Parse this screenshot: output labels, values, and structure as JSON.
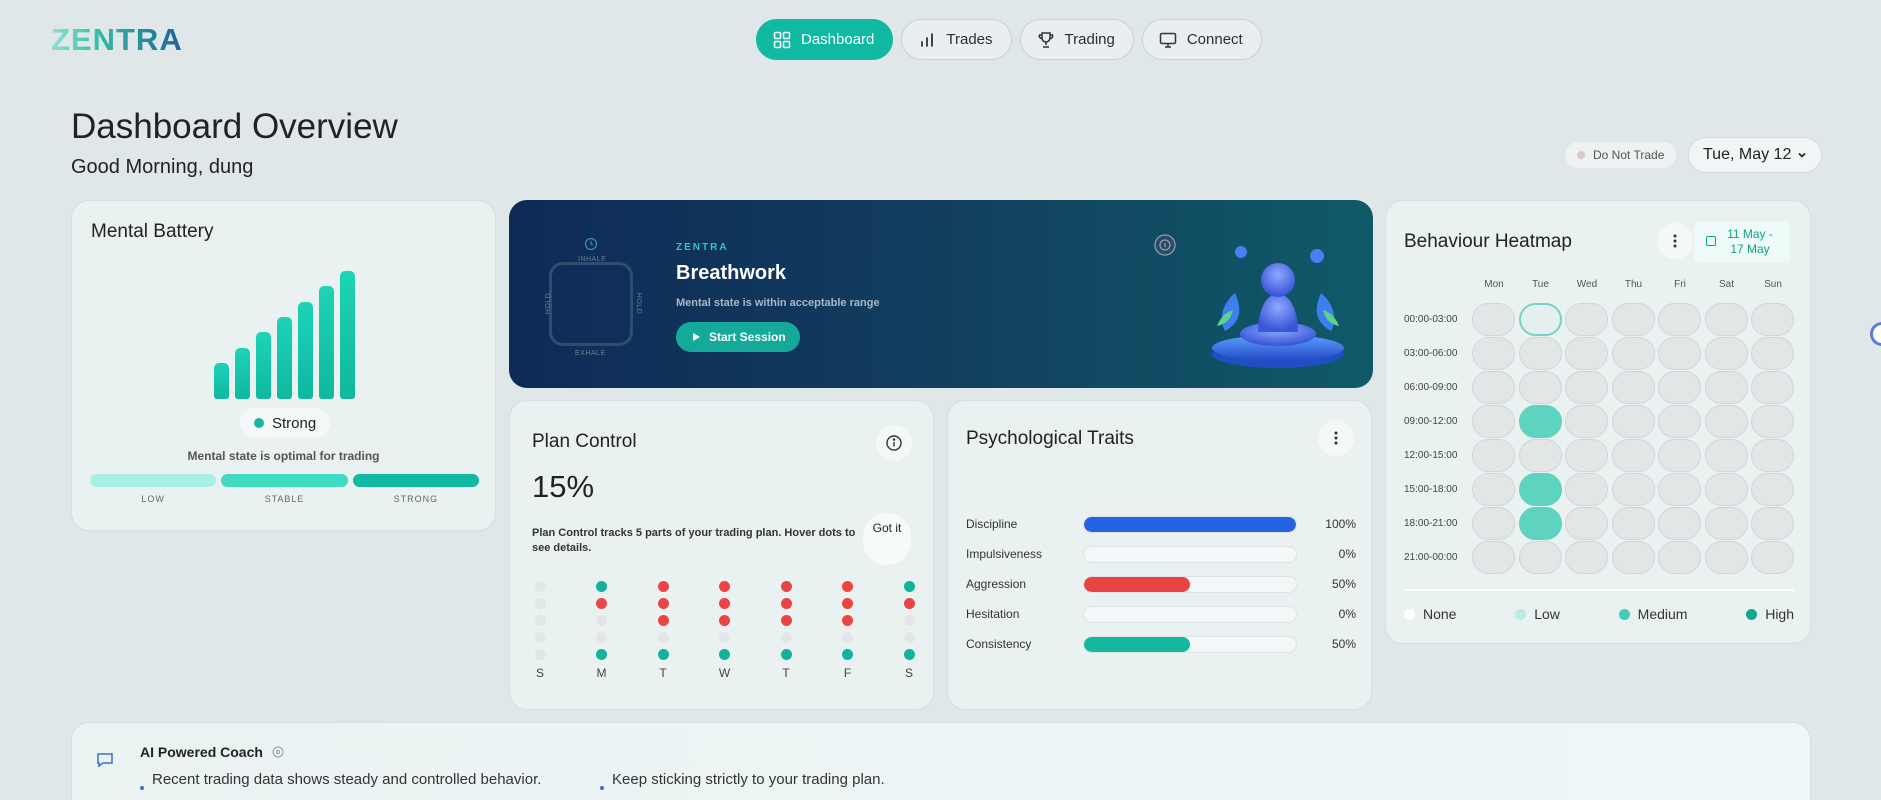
{
  "brand": {
    "logo": "ZENTRA"
  },
  "nav": [
    {
      "label": "Dashboard",
      "icon": "grid-icon",
      "active": true
    },
    {
      "label": "Trades",
      "icon": "bar-chart-icon",
      "active": false
    },
    {
      "label": "Trading",
      "icon": "trophy-icon",
      "active": false
    },
    {
      "label": "Connect",
      "icon": "monitor-icon",
      "active": false
    }
  ],
  "header": {
    "title": "Dashboard Overview",
    "greeting": "Good Morning, dung",
    "status_badge": "Do Not Trade",
    "date": "Tue, May 12"
  },
  "mental_battery": {
    "title": "Mental Battery",
    "bar_levels": [
      0.28,
      0.4,
      0.52,
      0.64,
      0.76,
      0.88,
      1.0
    ],
    "state": "Strong",
    "message": "Mental state is optimal for trading",
    "levels": [
      {
        "label": "LOW",
        "color": "#a8f0e3"
      },
      {
        "label": "STABLE",
        "color": "#3fdac1"
      },
      {
        "label": "STRONG",
        "color": "#10b9a2"
      }
    ]
  },
  "breathwork": {
    "brand": "ZENTRA",
    "title": "Breathwork",
    "subtitle": "Mental state is within acceptable range",
    "button": "Start Session",
    "box_labels": {
      "top": "INHALE",
      "right": "HOLD",
      "bottom": "EXHALE",
      "left": "HOLD"
    }
  },
  "plan_control": {
    "title": "Plan Control",
    "percent": "15%",
    "description": "Plan Control tracks 5 parts of your trading plan. Hover dots to see details.",
    "got_it": "Got it",
    "days": [
      {
        "day": "S",
        "dots": [
          "none",
          "none",
          "none",
          "none",
          "none"
        ]
      },
      {
        "day": "M",
        "dots": [
          "green",
          "red",
          "none",
          "none",
          "green"
        ]
      },
      {
        "day": "T",
        "dots": [
          "red",
          "red",
          "red",
          "none",
          "green"
        ]
      },
      {
        "day": "W",
        "dots": [
          "red",
          "red",
          "red",
          "none",
          "green"
        ]
      },
      {
        "day": "T",
        "dots": [
          "red",
          "red",
          "red",
          "none",
          "green"
        ]
      },
      {
        "day": "F",
        "dots": [
          "red",
          "red",
          "red",
          "none",
          "green"
        ]
      },
      {
        "day": "S",
        "dots": [
          "green",
          "red",
          "none",
          "none",
          "green"
        ]
      }
    ]
  },
  "traits": {
    "title": "Psychological Traits",
    "items": [
      {
        "name": "Discipline",
        "value": 100,
        "label": "100%",
        "color": "#2563e0"
      },
      {
        "name": "Impulsiveness",
        "value": 0,
        "label": "0%",
        "color": "#e0e0e0"
      },
      {
        "name": "Aggression",
        "value": 50,
        "label": "50%",
        "color": "#e84444"
      },
      {
        "name": "Hesitation",
        "value": 0,
        "label": "0%",
        "color": "#e0e0e0"
      },
      {
        "name": "Consistency",
        "value": 50,
        "label": "50%",
        "color": "#15b89f"
      }
    ]
  },
  "heatmap": {
    "title": "Behaviour Heatmap",
    "range": [
      "11 May -",
      "17 May"
    ],
    "days": [
      "Mon",
      "Tue",
      "Wed",
      "Thu",
      "Fri",
      "Sat",
      "Sun"
    ],
    "times": [
      "00:00-03:00",
      "03:00-06:00",
      "06:00-09:00",
      "09:00-12:00",
      "12:00-15:00",
      "15:00-18:00",
      "18:00-21:00",
      "21:00-00:00"
    ],
    "medium_cells": [
      [
        3,
        1
      ],
      [
        5,
        1
      ],
      [
        6,
        1
      ]
    ],
    "selected_cell": [
      0,
      1
    ],
    "legend": [
      {
        "label": "None",
        "color": "#ffffff"
      },
      {
        "label": "Low",
        "color": "#b6eee3"
      },
      {
        "label": "Medium",
        "color": "#3fcfb8"
      },
      {
        "label": "High",
        "color": "#12a890"
      }
    ]
  },
  "coach": {
    "title": "AI Powered Coach",
    "points": [
      "Recent trading data shows steady and controlled behavior.",
      "Keep sticking strictly to your trading plan."
    ]
  }
}
